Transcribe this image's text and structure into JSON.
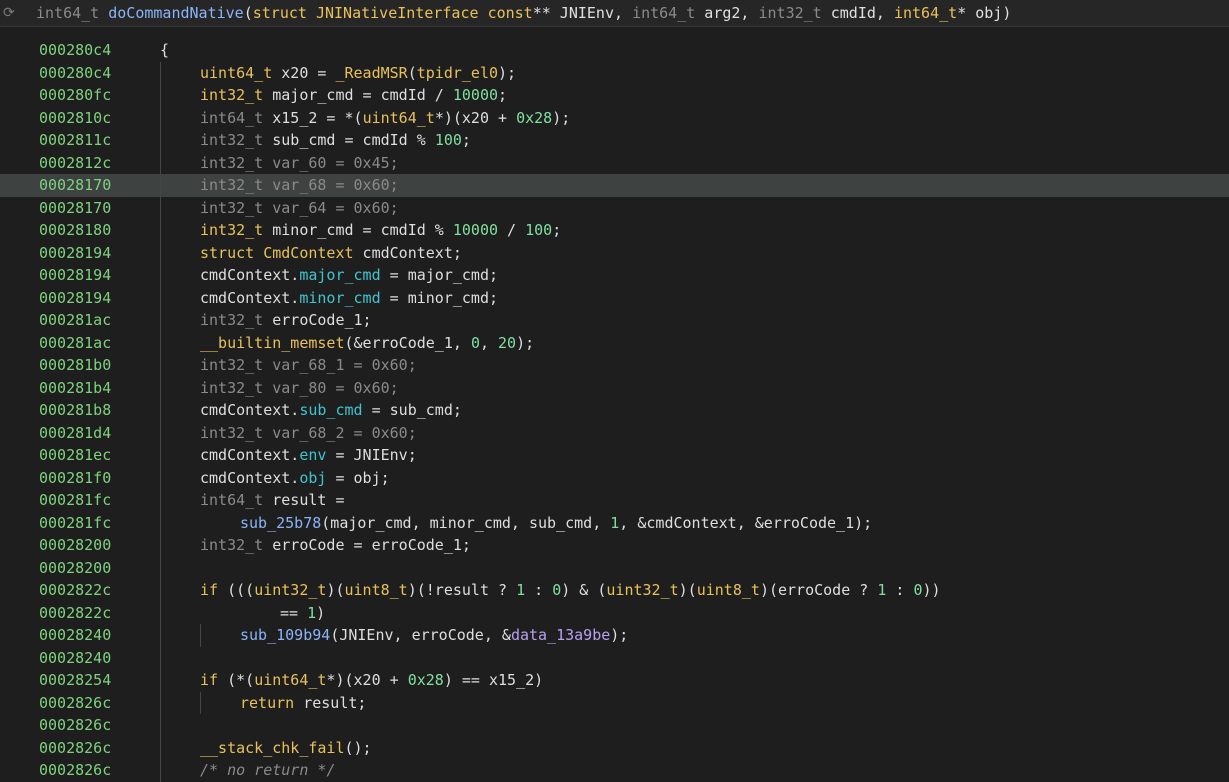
{
  "header": {
    "icon": "refresh-icon",
    "ret_type": "int64_t",
    "func_name": "doCommandNative",
    "params_html": "(struct JNINativeInterface const** JNIEnv, int64_t arg2, int32_t cmdId, int64_t* obj)"
  },
  "lines": [
    {
      "addr": "000280c4",
      "indent": 0,
      "segs": [
        [
          "o",
          "{"
        ]
      ]
    },
    {
      "addr": "000280c4",
      "indent": 1,
      "segs": [
        [
          "k",
          "uint64_t"
        ],
        [
          "o",
          " x20 = "
        ],
        [
          "f",
          "_ReadMSR"
        ],
        [
          "o",
          "("
        ],
        [
          "k",
          "tpidr_el0"
        ],
        [
          "o",
          ");"
        ]
      ]
    },
    {
      "addr": "000280fc",
      "indent": 1,
      "segs": [
        [
          "k",
          "int32_t"
        ],
        [
          "o",
          " major_cmd = cmdId / "
        ],
        [
          "n",
          "10000"
        ],
        [
          "o",
          ";"
        ]
      ]
    },
    {
      "addr": "0002810c",
      "indent": 1,
      "segs": [
        [
          "t",
          "int64_t"
        ],
        [
          "o",
          " x15_2 = *("
        ],
        [
          "k",
          "uint64_t"
        ],
        [
          "o",
          "*)(x20 + "
        ],
        [
          "n",
          "0x28"
        ],
        [
          "o",
          ");"
        ]
      ]
    },
    {
      "addr": "0002811c",
      "indent": 1,
      "segs": [
        [
          "t",
          "int32_t"
        ],
        [
          "o",
          " sub_cmd = cmdId % "
        ],
        [
          "n",
          "100"
        ],
        [
          "o",
          ";"
        ]
      ]
    },
    {
      "addr": "0002812c",
      "indent": 1,
      "segs": [
        [
          "d",
          "int32_t var_60 = 0x45;"
        ]
      ]
    },
    {
      "addr": "00028170",
      "indent": 1,
      "hl": true,
      "segs": [
        [
          "d",
          "int32_t var_68 = 0x60;"
        ]
      ]
    },
    {
      "addr": "00028170",
      "indent": 1,
      "segs": [
        [
          "d",
          "int32_t var_64 = 0x60;"
        ]
      ]
    },
    {
      "addr": "00028180",
      "indent": 1,
      "segs": [
        [
          "k",
          "int32_t"
        ],
        [
          "o",
          " minor_cmd = cmdId % "
        ],
        [
          "n",
          "10000"
        ],
        [
          "o",
          " / "
        ],
        [
          "n",
          "100"
        ],
        [
          "o",
          ";"
        ]
      ]
    },
    {
      "addr": "00028194",
      "indent": 1,
      "segs": [
        [
          "k",
          "struct"
        ],
        [
          "o",
          " "
        ],
        [
          "k",
          "CmdContext"
        ],
        [
          "o",
          " cmdContext;"
        ]
      ]
    },
    {
      "addr": "00028194",
      "indent": 1,
      "segs": [
        [
          "o",
          "cmdContext."
        ],
        [
          "m",
          "major_cmd"
        ],
        [
          "o",
          " = major_cmd;"
        ]
      ]
    },
    {
      "addr": "00028194",
      "indent": 1,
      "segs": [
        [
          "o",
          "cmdContext."
        ],
        [
          "m",
          "minor_cmd"
        ],
        [
          "o",
          " = minor_cmd;"
        ]
      ]
    },
    {
      "addr": "000281ac",
      "indent": 1,
      "segs": [
        [
          "t",
          "int32_t"
        ],
        [
          "o",
          " erroCode_1;"
        ]
      ]
    },
    {
      "addr": "000281ac",
      "indent": 1,
      "segs": [
        [
          "f",
          "__builtin_memset"
        ],
        [
          "o",
          "(&erroCode_1, "
        ],
        [
          "n",
          "0"
        ],
        [
          "o",
          ", "
        ],
        [
          "n",
          "20"
        ],
        [
          "o",
          ");"
        ]
      ]
    },
    {
      "addr": "000281b0",
      "indent": 1,
      "segs": [
        [
          "d",
          "int32_t var_68_1 = 0x60;"
        ]
      ]
    },
    {
      "addr": "000281b4",
      "indent": 1,
      "segs": [
        [
          "d",
          "int32_t var_80 = 0x60;"
        ]
      ]
    },
    {
      "addr": "000281b8",
      "indent": 1,
      "segs": [
        [
          "o",
          "cmdContext."
        ],
        [
          "m",
          "sub_cmd"
        ],
        [
          "o",
          " = sub_cmd;"
        ]
      ]
    },
    {
      "addr": "000281d4",
      "indent": 1,
      "segs": [
        [
          "d",
          "int32_t var_68_2 = 0x60;"
        ]
      ]
    },
    {
      "addr": "000281ec",
      "indent": 1,
      "segs": [
        [
          "o",
          "cmdContext."
        ],
        [
          "m",
          "env"
        ],
        [
          "o",
          " = JNIEnv;"
        ]
      ]
    },
    {
      "addr": "000281f0",
      "indent": 1,
      "segs": [
        [
          "o",
          "cmdContext."
        ],
        [
          "m",
          "obj"
        ],
        [
          "o",
          " = obj;"
        ]
      ]
    },
    {
      "addr": "000281fc",
      "indent": 1,
      "segs": [
        [
          "t",
          "int64_t"
        ],
        [
          "o",
          " result ="
        ]
      ]
    },
    {
      "addr": "000281fc",
      "indent": 2,
      "segs": [
        [
          "fn",
          "sub_25b78"
        ],
        [
          "o",
          "(major_cmd, minor_cmd, sub_cmd, "
        ],
        [
          "n",
          "1"
        ],
        [
          "o",
          ", &cmdContext, &erroCode_1);"
        ]
      ]
    },
    {
      "addr": "00028200",
      "indent": 1,
      "segs": [
        [
          "t",
          "int32_t"
        ],
        [
          "o",
          " erroCode = erroCode_1;"
        ]
      ]
    },
    {
      "addr": "00028200",
      "indent": 1,
      "segs": []
    },
    {
      "addr": "0002822c",
      "indent": 1,
      "segs": [
        [
          "k",
          "if"
        ],
        [
          "o",
          " ((("
        ],
        [
          "k",
          "uint32_t"
        ],
        [
          "o",
          ")("
        ],
        [
          "k",
          "uint8_t"
        ],
        [
          "o",
          ")(!result ? "
        ],
        [
          "n",
          "1"
        ],
        [
          "o",
          " : "
        ],
        [
          "n",
          "0"
        ],
        [
          "o",
          ") & ("
        ],
        [
          "k",
          "uint32_t"
        ],
        [
          "o",
          ")("
        ],
        [
          "k",
          "uint8_t"
        ],
        [
          "o",
          ")(erroCode ? "
        ],
        [
          "n",
          "1"
        ],
        [
          "o",
          " : "
        ],
        [
          "n",
          "0"
        ],
        [
          "o",
          "))"
        ]
      ]
    },
    {
      "addr": "0002822c",
      "indent": 3,
      "segs": [
        [
          "o",
          "== "
        ],
        [
          "n",
          "1"
        ],
        [
          "o",
          ")"
        ]
      ]
    },
    {
      "addr": "00028240",
      "indent": 2,
      "segs": [
        [
          "fn",
          "sub_109b94"
        ],
        [
          "o",
          "(JNIEnv, erroCode, &"
        ],
        [
          "s",
          "data_13a9be"
        ],
        [
          "o",
          ");"
        ]
      ]
    },
    {
      "addr": "00028240",
      "indent": 1,
      "segs": []
    },
    {
      "addr": "00028254",
      "indent": 1,
      "segs": [
        [
          "k",
          "if"
        ],
        [
          "o",
          " (*("
        ],
        [
          "k",
          "uint64_t"
        ],
        [
          "o",
          "*)(x20 + "
        ],
        [
          "n",
          "0x28"
        ],
        [
          "o",
          ") == x15_2)"
        ]
      ]
    },
    {
      "addr": "0002826c",
      "indent": 2,
      "segs": [
        [
          "k",
          "return"
        ],
        [
          "o",
          " result;"
        ]
      ]
    },
    {
      "addr": "0002826c",
      "indent": 1,
      "segs": []
    },
    {
      "addr": "0002826c",
      "indent": 1,
      "segs": [
        [
          "f",
          "__stack_chk_fail"
        ],
        [
          "o",
          "();"
        ]
      ]
    },
    {
      "addr": "0002826c",
      "indent": 1,
      "segs": [
        [
          "c",
          "/* no return */"
        ]
      ]
    }
  ]
}
